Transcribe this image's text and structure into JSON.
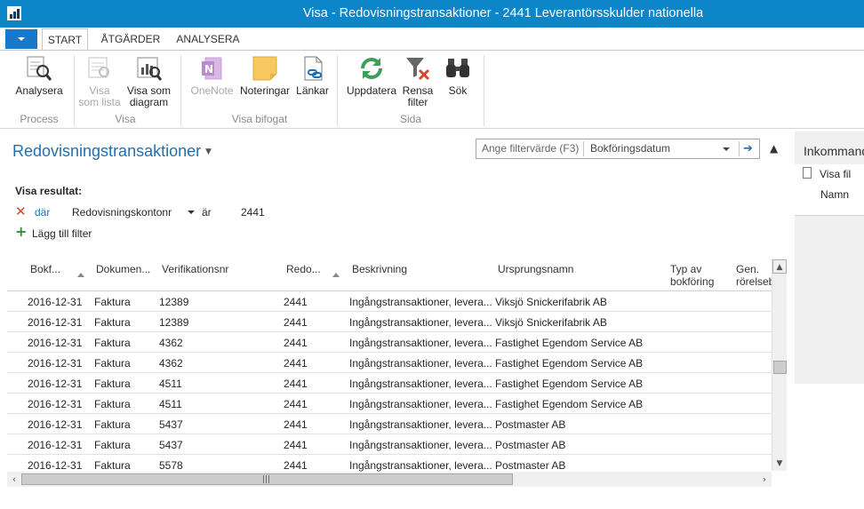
{
  "window": {
    "title": "Visa - Redovisningstransaktioner - 2441 Leverantörsskulder nationella"
  },
  "ribbon": {
    "tabs": [
      {
        "label": "START",
        "active": true
      },
      {
        "label": "ÅTGÄRDER",
        "active": false
      },
      {
        "label": "ANALYSERA",
        "active": false
      }
    ],
    "groups": {
      "process": "Process",
      "visa": "Visa",
      "visa_bifogat": "Visa bifogat",
      "sida": "Sida"
    },
    "buttons": {
      "analysera": "Analysera",
      "visa_som_lista": "Visa\nsom lista",
      "visa_som_diagram": "Visa som\ndiagram",
      "onenote": "OneNote",
      "noteringar": "Noteringar",
      "lankar": "Länkar",
      "uppdatera": "Uppdatera",
      "rensa_filter": "Rensa\nfilter",
      "sok": "Sök"
    }
  },
  "page": {
    "title": "Redovisningstransaktioner",
    "filter_placeholder": "Ange filtervärde (F3)",
    "filter_field": "Bokföringsdatum",
    "show_results_label": "Visa resultat:",
    "filter_where": "där",
    "filter_field_name": "Redovisningskontonr",
    "filter_operator": "är",
    "filter_value": "2441",
    "add_filter_label": "Lägg till filter"
  },
  "grid": {
    "columns": [
      "Bokf...",
      "Dokumen...",
      "Verifikationsnr",
      "Redo...",
      "Beskrivning",
      "Ursprungsnamn",
      "Typ av\nbokföring",
      "Gen.\nrörelseb"
    ],
    "rows": [
      [
        "2016-12-31",
        "Faktura",
        "12389",
        "2441",
        "Ingångstransaktioner, levera...",
        "Viksjö Snickerifabrik AB"
      ],
      [
        "2016-12-31",
        "Faktura",
        "12389",
        "2441",
        "Ingångstransaktioner, levera...",
        "Viksjö Snickerifabrik AB"
      ],
      [
        "2016-12-31",
        "Faktura",
        "4362",
        "2441",
        "Ingångstransaktioner, levera...",
        "Fastighet Egendom Service AB"
      ],
      [
        "2016-12-31",
        "Faktura",
        "4362",
        "2441",
        "Ingångstransaktioner, levera...",
        "Fastighet Egendom Service AB"
      ],
      [
        "2016-12-31",
        "Faktura",
        "4511",
        "2441",
        "Ingångstransaktioner, levera...",
        "Fastighet Egendom Service AB"
      ],
      [
        "2016-12-31",
        "Faktura",
        "4511",
        "2441",
        "Ingångstransaktioner, levera...",
        "Fastighet Egendom Service AB"
      ],
      [
        "2016-12-31",
        "Faktura",
        "5437",
        "2441",
        "Ingångstransaktioner, levera...",
        "Postmaster AB"
      ],
      [
        "2016-12-31",
        "Faktura",
        "5437",
        "2441",
        "Ingångstransaktioner, levera...",
        "Postmaster AB"
      ],
      [
        "2016-12-31",
        "Faktura",
        "5578",
        "2441",
        "Ingångstransaktioner, levera...",
        "Postmaster AB"
      ]
    ]
  },
  "factbox": {
    "title": "Inkommande",
    "visa_fil": "Visa fil",
    "namn": "Namn"
  },
  "colors": {
    "titlebar": "#0c86c9",
    "accent": "#1f6fb2",
    "remove_filter": "#d04a2b",
    "add_filter": "#3a8a3a"
  }
}
